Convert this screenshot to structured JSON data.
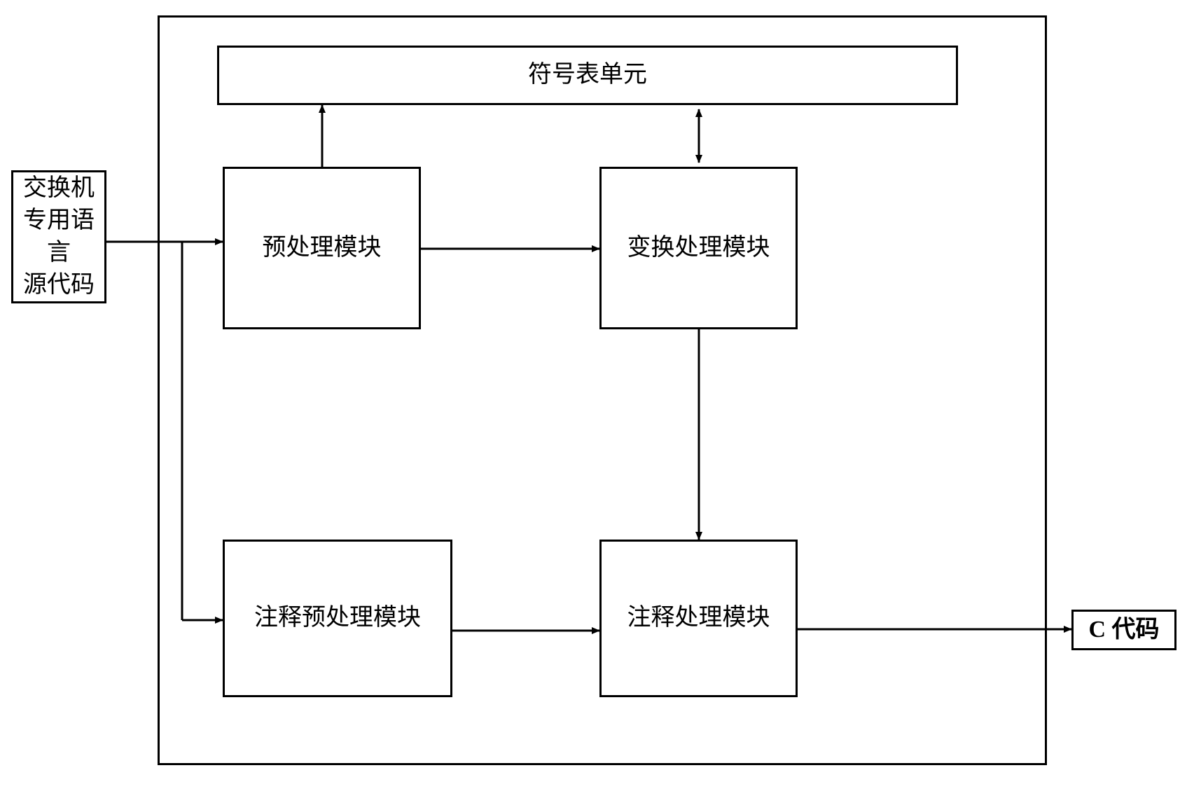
{
  "input_box": {
    "label": "交换机\n专用语言\n源代码"
  },
  "outer_container": {},
  "symbol_table": {
    "label": "符号表单元"
  },
  "preprocess": {
    "label": "预处理模块"
  },
  "transform": {
    "label": "变换处理模块"
  },
  "comment_preprocess": {
    "label": "注释预处理模块"
  },
  "comment_process": {
    "label": "注释处理模块"
  },
  "output_box": {
    "label": "C 代码"
  }
}
